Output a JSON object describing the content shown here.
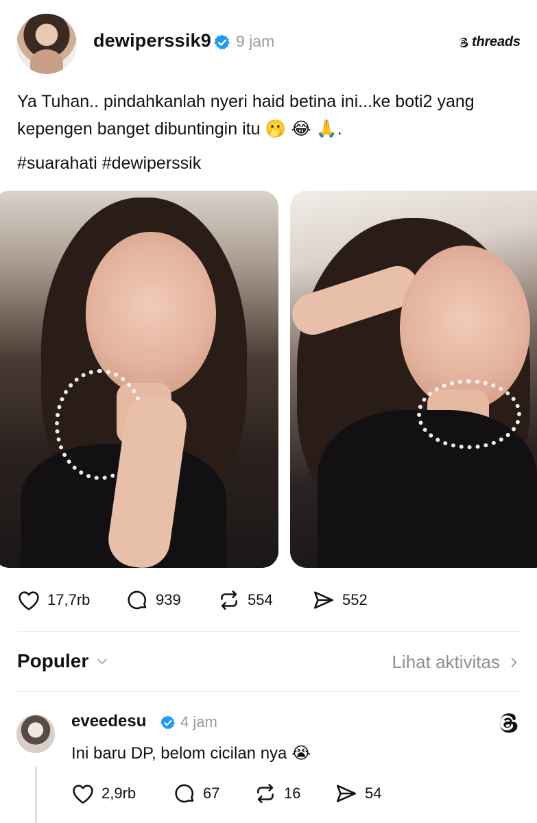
{
  "post": {
    "username": "dewiperssik9",
    "time_ago": "9 jam",
    "brand": "threads",
    "text": "Ya Tuhan.. pindahkanlah nyeri haid betina ini...ke boti2 yang kepengen banget dibuntingin itu 🫢 😂 🙏.",
    "hashtags": "#suarahati #dewiperssik",
    "stats": {
      "likes": "17,7rb",
      "replies": "939",
      "reposts": "554",
      "shares": "552"
    }
  },
  "section": {
    "title": "Populer",
    "activity_link": "Lihat aktivitas"
  },
  "comment": {
    "username": "eveedesu",
    "time_ago": "4 jam",
    "text": "Ini baru DP, belom cicilan nya 😭",
    "stats": {
      "likes": "2,9rb",
      "replies": "67",
      "reposts": "16",
      "shares": "54"
    }
  },
  "icons": {
    "verified_color": "#1d9bf0"
  }
}
